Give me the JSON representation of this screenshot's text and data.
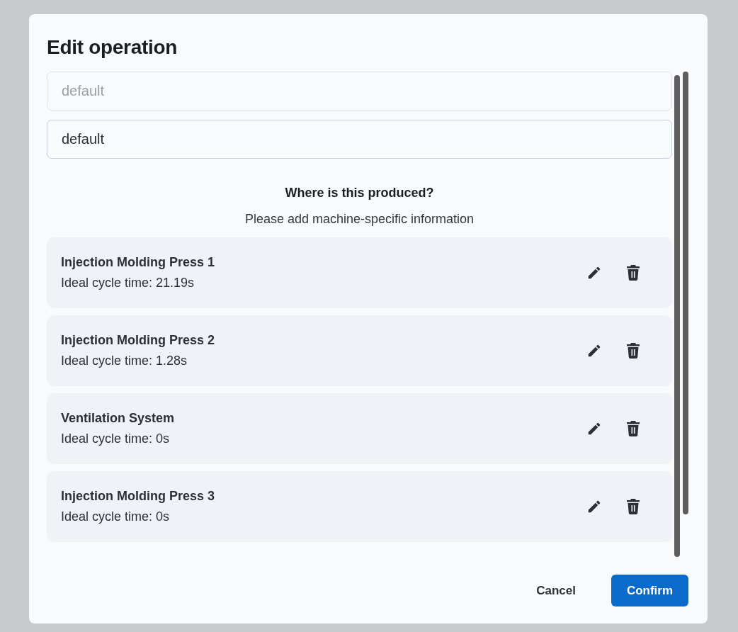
{
  "dialog": {
    "title": "Edit operation"
  },
  "fields": [
    {
      "placeholder": "default"
    },
    {
      "value": "default"
    }
  ],
  "section": {
    "heading": "Where is this produced?",
    "subtitle": "Please add machine-specific information"
  },
  "machines": [
    {
      "name": "Injection Molding Press 1",
      "cycle": "Ideal cycle time: 21.19s"
    },
    {
      "name": "Injection Molding Press 2",
      "cycle": "Ideal cycle time: 1.28s"
    },
    {
      "name": "Ventilation System",
      "cycle": "Ideal cycle time: 0s"
    },
    {
      "name": "Injection Molding Press 3",
      "cycle": "Ideal cycle time: 0s"
    }
  ],
  "buttons": [
    {
      "label": "Cancel",
      "kind": "secondary"
    },
    {
      "label": "Confirm",
      "kind": "primary"
    }
  ]
}
